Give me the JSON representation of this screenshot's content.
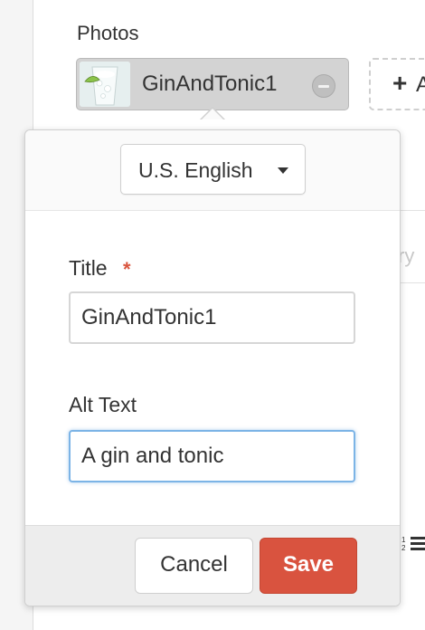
{
  "photos": {
    "section_label": "Photos",
    "selected_photo": {
      "name": "GinAndTonic1",
      "thumbnail_icon": "gin-and-tonic-thumbnail"
    },
    "add_button": {
      "plus": "+",
      "label_partial": "A"
    }
  },
  "background": {
    "faint_text": "ry"
  },
  "popover": {
    "language": "U.S. English",
    "title_field": {
      "label": "Title",
      "required_mark": "*",
      "value": "GinAndTonic1"
    },
    "alt_text_field": {
      "label": "Alt Text",
      "value": "A gin and tonic"
    },
    "buttons": {
      "cancel": "Cancel",
      "save": "Save"
    }
  },
  "colors": {
    "save_button": "#d9533f",
    "required_star": "#d9553e",
    "focus_border": "#7cb4e6",
    "chip_background": "#d3d3d3"
  }
}
